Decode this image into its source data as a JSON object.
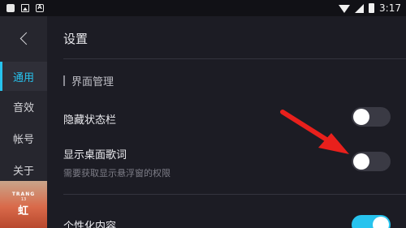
{
  "statusbar": {
    "time": "3:17",
    "left_icons": [
      "app-icon",
      "image-icon",
      "a-icon"
    ],
    "right_icons": [
      "wifi-icon",
      "signal-icon",
      "battery-icon"
    ]
  },
  "sidebar": {
    "items": [
      {
        "label": "通用",
        "active": true
      },
      {
        "label": "音效",
        "active": false
      },
      {
        "label": "帐号",
        "active": false
      },
      {
        "label": "关于",
        "active": false
      }
    ],
    "album": {
      "line1": "TRANG",
      "line2": "13",
      "line3": "虹"
    }
  },
  "header": {
    "title": "设置"
  },
  "section": {
    "title": "界面管理"
  },
  "settings": [
    {
      "label": "隐藏状态栏",
      "enabled": false
    },
    {
      "label": "显示桌面歌词",
      "sub": "需要获取显示悬浮窗的权限",
      "enabled": false
    },
    {
      "label": "个性化内容",
      "enabled": true
    }
  ],
  "colors": {
    "accent": "#27c3ee",
    "annotation_arrow": "#e8201c",
    "background": "#1c1c24"
  }
}
